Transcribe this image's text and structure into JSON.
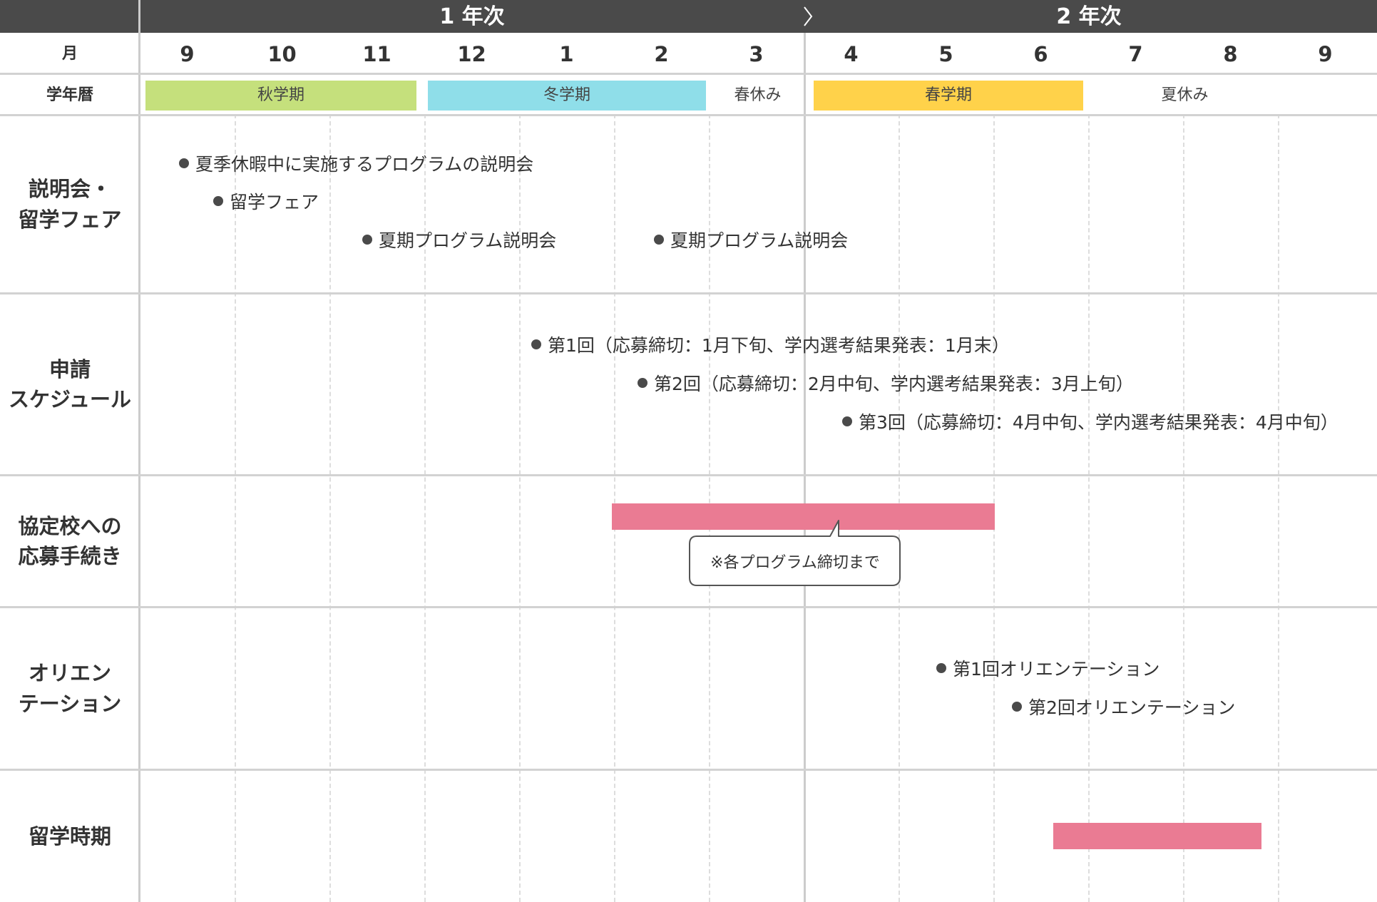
{
  "header": {
    "year1": "1 年次",
    "year2": "2 年次",
    "month_label": "月",
    "calendar_label": "学年暦"
  },
  "months": [
    "9",
    "10",
    "11",
    "12",
    "1",
    "2",
    "3",
    "4",
    "5",
    "6",
    "7",
    "8",
    "9"
  ],
  "terms": [
    {
      "label": "秋学期",
      "color": "#c5e07c"
    },
    {
      "label": "冬学期",
      "color": "#8fdee9"
    },
    {
      "label": "春休み",
      "color": ""
    },
    {
      "label": "春学期",
      "color": "#ffd24a"
    },
    {
      "label": "夏休み",
      "color": ""
    }
  ],
  "rows": [
    {
      "title_lines": [
        "説明会・",
        "留学フェア"
      ]
    },
    {
      "title_lines": [
        "申請",
        "スケジュール"
      ]
    },
    {
      "title_lines": [
        "協定校への",
        "応募手続き"
      ]
    },
    {
      "title_lines": [
        "オリエン",
        "テーション"
      ]
    },
    {
      "title_lines": [
        "留学時期"
      ]
    }
  ],
  "events": {
    "info": [
      "夏季休暇中に実施するプログラムの説明会",
      "留学フェア",
      "夏期プログラム説明会",
      "夏期プログラム説明会"
    ],
    "application": [
      "第1回（応募締切：1月下旬、学内選考結果発表：1月末）",
      "第2回（応募締切：2月中旬、学内選考結果発表：3月上旬）",
      "第3回（応募締切：4月中旬、学内選考結果発表：4月中旬）"
    ],
    "orientation": [
      "第1回オリエンテーション",
      "第2回オリエンテーション"
    ]
  },
  "callout": {
    "text": "※各プログラム締切まで"
  },
  "colors": {
    "header_bg": "#4a4a4a",
    "bar": "#ea7b93",
    "grid": "#cccccc",
    "text": "#333333"
  }
}
